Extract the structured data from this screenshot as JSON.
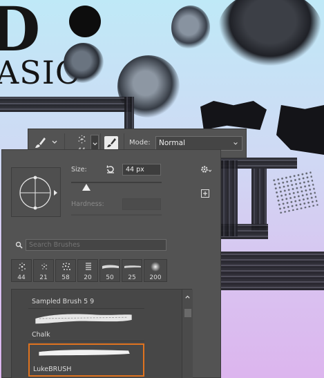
{
  "canvas": {
    "letters": {
      "d": "D",
      "asic": "ASIC"
    }
  },
  "options_bar": {
    "tool_icon": "paintbrush-icon",
    "preset_size": "44",
    "mode_label": "Mode:",
    "mode_value": "Normal"
  },
  "brush_panel": {
    "size_label": "Size:",
    "size_value": "44 px",
    "size_slider_fraction": 0.17,
    "hardness_label": "Hardness:",
    "search_placeholder": "Search Brushes",
    "recent_brushes": [
      {
        "size": "44",
        "icon": "spatter-brush-icon"
      },
      {
        "size": "21",
        "icon": "spatter-brush-icon"
      },
      {
        "size": "58",
        "icon": "spatter-brush-icon"
      },
      {
        "size": "20",
        "icon": "lines-brush-icon"
      },
      {
        "size": "50",
        "icon": "chalk-stroke-icon"
      },
      {
        "size": "25",
        "icon": "chalk-stroke-icon"
      },
      {
        "size": "200",
        "icon": "soft-round-brush-icon"
      }
    ],
    "brushes": [
      {
        "name": "Sampled Brush 5 9"
      },
      {
        "name": "Chalk"
      },
      {
        "name": "LukeBRUSH",
        "selected": true
      }
    ],
    "accent_color": "#e0731f"
  }
}
